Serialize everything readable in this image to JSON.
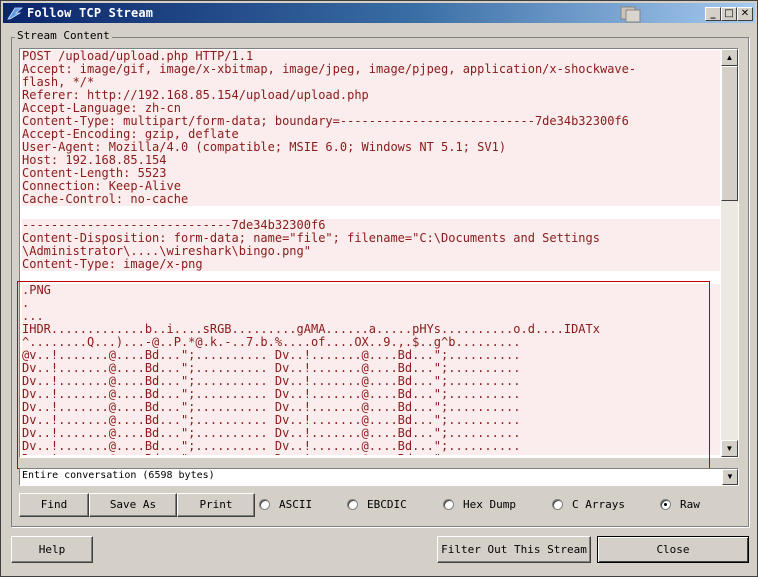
{
  "window": {
    "title": "Follow TCP Stream"
  },
  "title_buttons": {
    "minimize": "_",
    "maximize": "□",
    "close": "✕"
  },
  "group": {
    "label": "Stream Content"
  },
  "stream_lines": [
    "POST /upload/upload.php HTTP/1.1",
    "Accept: image/gif, image/x-xbitmap, image/jpeg, image/pjpeg, application/x-shockwave-",
    "flash, */*",
    "Referer: http://192.168.85.154/upload/upload.php",
    "Accept-Language: zh-cn",
    "Content-Type: multipart/form-data; boundary=---------------------------7de34b32300f6",
    "Accept-Encoding: gzip, deflate",
    "User-Agent: Mozilla/4.0 (compatible; MSIE 6.0; Windows NT 5.1; SV1)",
    "Host: 192.168.85.154",
    "Content-Length: 5523",
    "Connection: Keep-Alive",
    "Cache-Control: no-cache",
    "",
    "-----------------------------7de34b32300f6",
    "Content-Disposition: form-data; name=\"file\"; filename=\"C:\\Documents and Settings",
    "\\Administrator\\....\\wireshark\\bingo.png\"",
    "Content-Type: image/x-png",
    "",
    ".PNG",
    ".",
    "...",
    "IHDR.............b..i....sRGB.........gAMA......a.....pHYs..........o.d....IDATx",
    "^........Q...)...-@..P.*@.k.-..7.b.%....of....OX..9.,.$..g^b.........",
    "@v..!.......@....Bd...\";.......... Dv..!.......@....Bd...\";..........",
    "Dv..!.......@....Bd...\";.......... Dv..!.......@....Bd...\";..........",
    "Dv..!.......@....Bd...\";.......... Dv..!.......@....Bd...\";..........",
    "Dv..!.......@....Bd...\";.......... Dv..!.......@....Bd...\";..........",
    "Dv..!.......@....Bd...\";.......... Dv..!.......@....Bd...\";..........",
    "Dv..!.......@....Bd...\";.......... Dv..!.......@....Bd...\";..........",
    "Dv..!.......@....Bd...\";.......... Dv..!.......@....Bd...\";..........",
    "Dv..!.......@....Bd...\";.......... Dv..!.......@....Bd...\";..........",
    "Dv..!.......@....Bd...\";.......... Dv..!.......@....Bd...\";.........."
  ],
  "conversation_select": {
    "value": "Entire conversation (6598 bytes)"
  },
  "buttons": {
    "find": "Find",
    "save_as": "Save As",
    "print": "Print",
    "help": "Help",
    "filter_out": "Filter Out This Stream",
    "close": "Close"
  },
  "radios": [
    {
      "label": "ASCII",
      "checked": false
    },
    {
      "label": "EBCDIC",
      "checked": false
    },
    {
      "label": "Hex Dump",
      "checked": false
    },
    {
      "label": "C Arrays",
      "checked": false
    },
    {
      "label": "Raw",
      "checked": true
    }
  ],
  "colors": {
    "stream_text": "#8b1a1a",
    "stream_bg": "#fbeded",
    "title_gradient_start": "#0a246a",
    "highlight_border": "#c00000"
  }
}
